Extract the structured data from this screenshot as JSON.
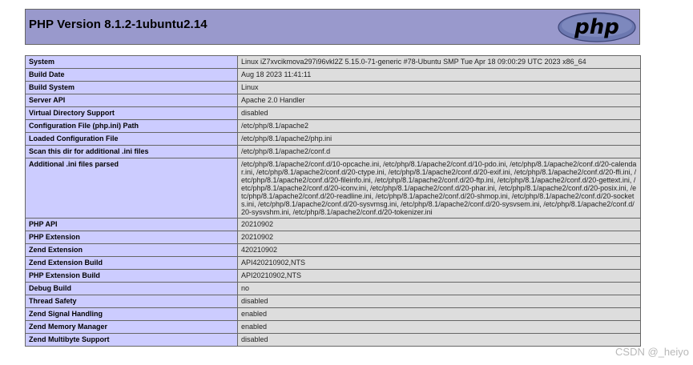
{
  "header": {
    "title": "PHP Version 8.1.2-1ubuntu2.14",
    "logo_text": "php"
  },
  "rows": [
    {
      "key": "System",
      "value": "Linux iZ7xvcikmova297i96vkl2Z 5.15.0-71-generic #78-Ubuntu SMP Tue Apr 18 09:00:29 UTC 2023 x86_64"
    },
    {
      "key": "Build Date",
      "value": "Aug 18 2023 11:41:11"
    },
    {
      "key": "Build System",
      "value": "Linux"
    },
    {
      "key": "Server API",
      "value": "Apache 2.0 Handler"
    },
    {
      "key": "Virtual Directory Support",
      "value": "disabled"
    },
    {
      "key": "Configuration File (php.ini) Path",
      "value": "/etc/php/8.1/apache2"
    },
    {
      "key": "Loaded Configuration File",
      "value": "/etc/php/8.1/apache2/php.ini"
    },
    {
      "key": "Scan this dir for additional .ini files",
      "value": "/etc/php/8.1/apache2/conf.d"
    },
    {
      "key": "Additional .ini files parsed",
      "value": "/etc/php/8.1/apache2/conf.d/10-opcache.ini, /etc/php/8.1/apache2/conf.d/10-pdo.ini, /etc/php/8.1/apache2/conf.d/20-calendar.ini, /etc/php/8.1/apache2/conf.d/20-ctype.ini, /etc/php/8.1/apache2/conf.d/20-exif.ini, /etc/php/8.1/apache2/conf.d/20-ffi.ini, /etc/php/8.1/apache2/conf.d/20-fileinfo.ini, /etc/php/8.1/apache2/conf.d/20-ftp.ini, /etc/php/8.1/apache2/conf.d/20-gettext.ini, /etc/php/8.1/apache2/conf.d/20-iconv.ini, /etc/php/8.1/apache2/conf.d/20-phar.ini, /etc/php/8.1/apache2/conf.d/20-posix.ini, /etc/php/8.1/apache2/conf.d/20-readline.ini, /etc/php/8.1/apache2/conf.d/20-shmop.ini, /etc/php/8.1/apache2/conf.d/20-sockets.ini, /etc/php/8.1/apache2/conf.d/20-sysvmsg.ini, /etc/php/8.1/apache2/conf.d/20-sysvsem.ini, /etc/php/8.1/apache2/conf.d/20-sysvshm.ini, /etc/php/8.1/apache2/conf.d/20-tokenizer.ini"
    },
    {
      "key": "PHP API",
      "value": "20210902"
    },
    {
      "key": "PHP Extension",
      "value": "20210902"
    },
    {
      "key": "Zend Extension",
      "value": "420210902"
    },
    {
      "key": "Zend Extension Build",
      "value": "API420210902,NTS"
    },
    {
      "key": "PHP Extension Build",
      "value": "API20210902,NTS"
    },
    {
      "key": "Debug Build",
      "value": "no"
    },
    {
      "key": "Thread Safety",
      "value": "disabled"
    },
    {
      "key": "Zend Signal Handling",
      "value": "enabled"
    },
    {
      "key": "Zend Memory Manager",
      "value": "enabled"
    },
    {
      "key": "Zend Multibyte Support",
      "value": "disabled"
    }
  ],
  "watermark": "CSDN @_heiyo",
  "colors": {
    "header_bg": "#9999cc",
    "key_bg": "#ccccff",
    "value_bg": "#dddddd",
    "logo_bg": "#6c78b0"
  }
}
